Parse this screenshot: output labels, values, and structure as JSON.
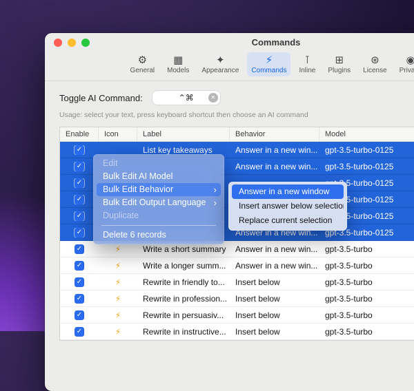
{
  "window": {
    "title": "Commands"
  },
  "icons": {
    "check": "✓",
    "chevron_right": "›",
    "clear": "✕"
  },
  "toolbar": {
    "items": [
      {
        "item_name": "toolbar-item-general",
        "icon_name": "gear-icon",
        "glyph": "⚙",
        "label": "General",
        "selected": false
      },
      {
        "item_name": "toolbar-item-models",
        "icon_name": "models-icon",
        "glyph": "▦",
        "label": "Models",
        "selected": false
      },
      {
        "item_name": "toolbar-item-appearance",
        "icon_name": "appearance-icon",
        "glyph": "✦",
        "label": "Appearance",
        "selected": false
      },
      {
        "item_name": "toolbar-item-commands",
        "icon_name": "commands-icon",
        "glyph": "⚡",
        "label": "Commands",
        "selected": true
      },
      {
        "item_name": "toolbar-item-inline",
        "icon_name": "inline-icon",
        "glyph": "⊺",
        "label": "Inline",
        "selected": false
      },
      {
        "item_name": "toolbar-item-plugins",
        "icon_name": "plugins-icon",
        "glyph": "⊞",
        "label": "Plugins",
        "selected": false
      },
      {
        "item_name": "toolbar-item-license",
        "icon_name": "license-icon",
        "glyph": "⊛",
        "label": "License",
        "selected": false
      },
      {
        "item_name": "toolbar-item-privacy",
        "icon_name": "privacy-icon",
        "glyph": "◉",
        "label": "Privacy",
        "selected": false
      }
    ]
  },
  "shortcut": {
    "label": "Toggle AI Command:",
    "value": "⌃⌘"
  },
  "usage": "Usage: select your text, press keyboard shortcut then choose an AI command",
  "table": {
    "columns": [
      {
        "label": "Enable"
      },
      {
        "label": "Icon"
      },
      {
        "label": "Label"
      },
      {
        "label": "Behavior"
      },
      {
        "label": "Model"
      }
    ],
    "rows": [
      {
        "enabled": true,
        "selected": true,
        "icon_glyph": "",
        "icon_name": "",
        "label": "List key takeaways",
        "behavior": "Answer in a new win...",
        "model": "gpt-3.5-turbo-0125"
      },
      {
        "enabled": true,
        "selected": true,
        "icon_glyph": "",
        "icon_name": "",
        "label": "",
        "behavior": "Answer in a new win...",
        "model": "gpt-3.5-turbo-0125"
      },
      {
        "enabled": true,
        "selected": true,
        "icon_glyph": "",
        "icon_name": "",
        "label": "",
        "behavior": "",
        "model": "gpt-3.5-turbo-0125"
      },
      {
        "enabled": true,
        "selected": true,
        "icon_glyph": "",
        "icon_name": "",
        "label": "",
        "behavior": "",
        "model": "gpt-3.5-turbo-0125"
      },
      {
        "enabled": true,
        "selected": true,
        "icon_glyph": "",
        "icon_name": "",
        "label": "",
        "behavior": "",
        "model": "gpt-3.5-turbo-0125"
      },
      {
        "enabled": true,
        "selected": true,
        "icon_glyph": "",
        "icon_name": "",
        "label": "",
        "behavior": "Answer in a new win...",
        "model": "gpt-3.5-turbo-0125"
      },
      {
        "enabled": true,
        "selected": false,
        "icon_glyph": "⚡",
        "icon_name": "bolt-icon",
        "label": "Write a short summary",
        "behavior": "Answer in a new win...",
        "model": "gpt-3.5-turbo"
      },
      {
        "enabled": true,
        "selected": false,
        "icon_glyph": "⚡",
        "icon_name": "bolt-icon",
        "label": "Write a longer summ...",
        "behavior": "Answer in a new win...",
        "model": "gpt-3.5-turbo"
      },
      {
        "enabled": true,
        "selected": false,
        "icon_glyph": "⚡",
        "icon_name": "bolt-icon",
        "label": "Rewrite in friendly to...",
        "behavior": "Insert below",
        "model": "gpt-3.5-turbo"
      },
      {
        "enabled": true,
        "selected": false,
        "icon_glyph": "⚡",
        "icon_name": "bolt-icon",
        "label": "Rewrite in profession...",
        "behavior": "Insert below",
        "model": "gpt-3.5-turbo"
      },
      {
        "enabled": true,
        "selected": false,
        "icon_glyph": "⚡",
        "icon_name": "bolt-icon",
        "label": "Rewrite in persuasiv...",
        "behavior": "Insert below",
        "model": "gpt-3.5-turbo"
      },
      {
        "enabled": true,
        "selected": false,
        "icon_glyph": "⚡",
        "icon_name": "bolt-icon",
        "label": "Rewrite in instructive...",
        "behavior": "Insert below",
        "model": "gpt-3.5-turbo"
      }
    ]
  },
  "context_menu": {
    "items": [
      {
        "label": "Edit",
        "disabled": true
      },
      {
        "label": "Bulk Edit AI Model"
      },
      {
        "label": "Bulk Edit Behavior",
        "highlighted": true,
        "has_submenu": true
      },
      {
        "label": "Bulk Edit Output Language",
        "has_submenu": true
      },
      {
        "label": "Duplicate",
        "disabled": true
      },
      {
        "separator": true
      },
      {
        "label": "Delete 6 records"
      }
    ]
  },
  "submenu": {
    "items": [
      {
        "label": "Answer in a new window",
        "highlighted": true
      },
      {
        "label": "Insert answer below selection"
      },
      {
        "label": "Replace current selection"
      }
    ]
  },
  "colors": {
    "selection_blue": "#2264da",
    "accent_blue": "#1565e2",
    "menu_highlight": "#4f83ec",
    "bolt_orange": "#f7a71d"
  }
}
